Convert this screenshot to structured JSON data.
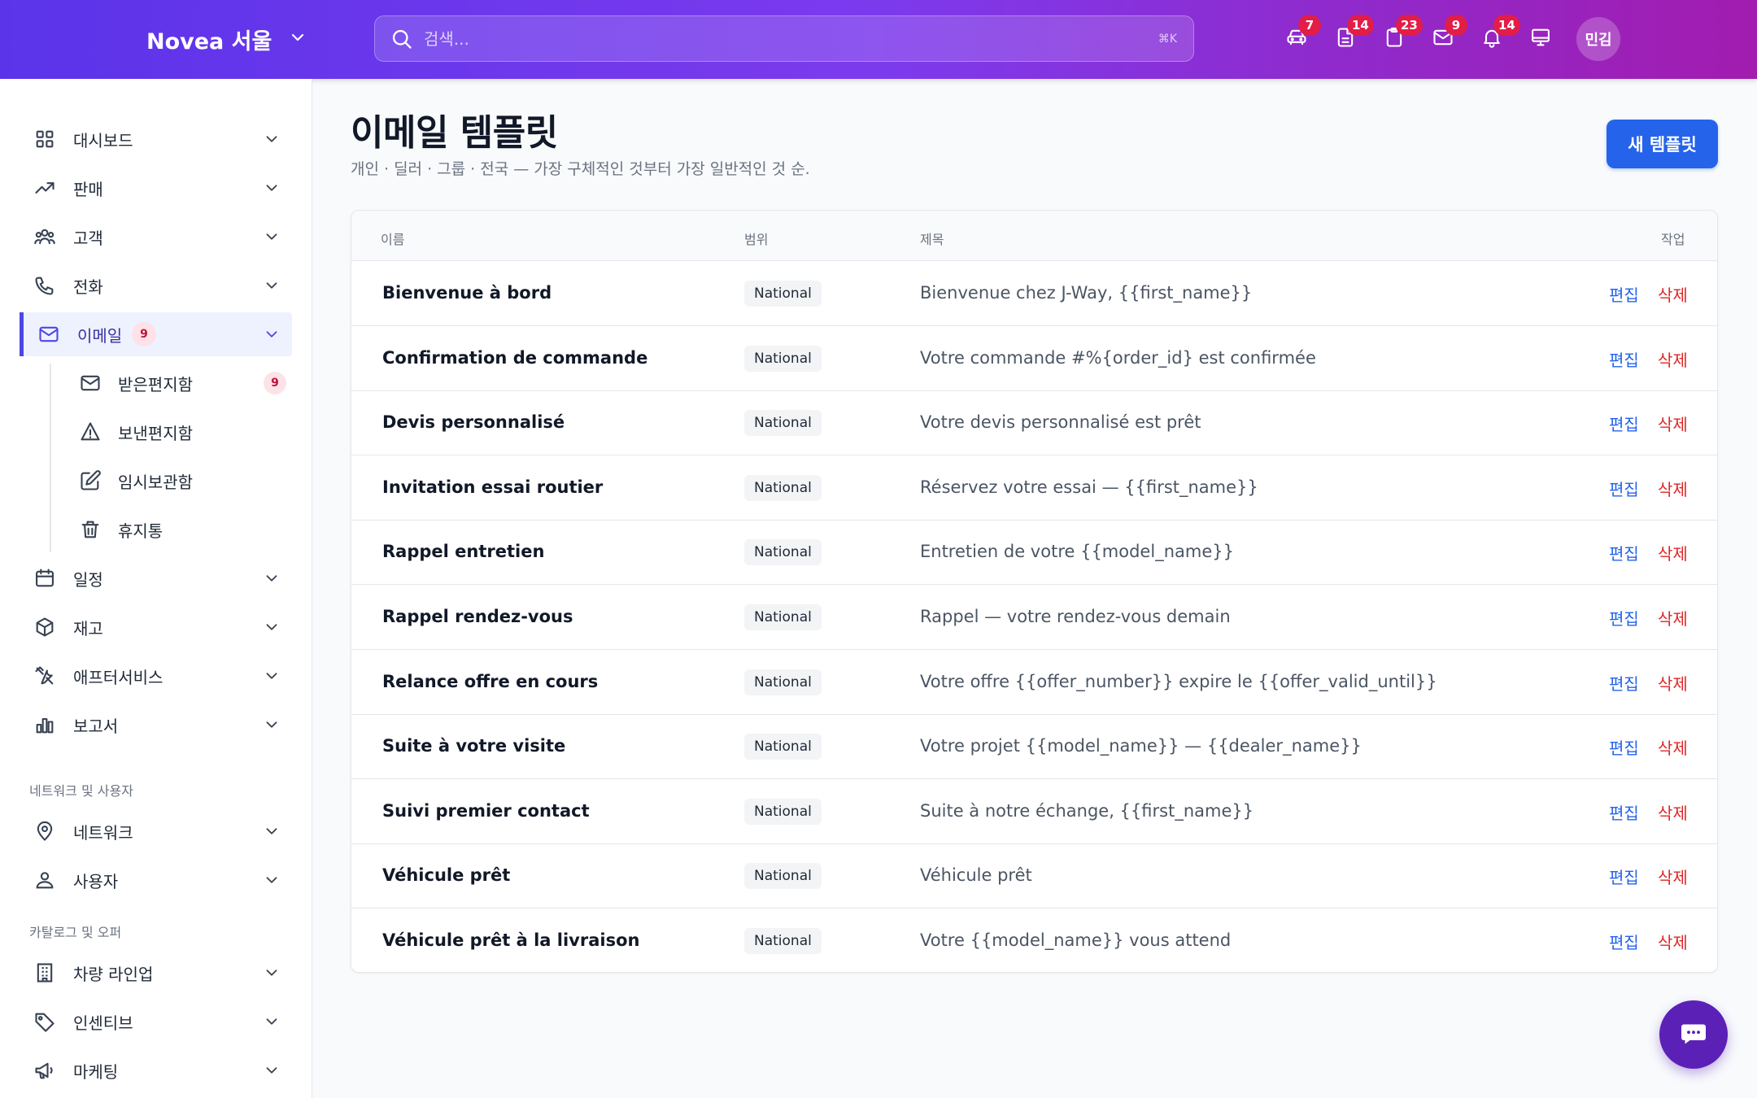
{
  "header": {
    "brand": "Novea 서울",
    "search_placeholder": "검색...",
    "search_shortcut": "⌘K",
    "icons": [
      {
        "icon": "car-icon",
        "badge": "7"
      },
      {
        "icon": "document-icon",
        "badge": "14"
      },
      {
        "icon": "clipboard-icon",
        "badge": "23"
      },
      {
        "icon": "mail-icon",
        "badge": "9"
      },
      {
        "icon": "bell-icon",
        "badge": "14"
      },
      {
        "icon": "monitor-icon",
        "badge": ""
      }
    ],
    "avatar_initials": "민김"
  },
  "sidebar": {
    "items": [
      {
        "label": "대시보드",
        "icon": "grid-icon"
      },
      {
        "label": "판매",
        "icon": "trending-up-icon"
      },
      {
        "label": "고객",
        "icon": "users-icon"
      },
      {
        "label": "전화",
        "icon": "phone-icon"
      },
      {
        "label": "이메일",
        "icon": "mail-icon",
        "badge": "9",
        "active": true
      },
      {
        "label": "일정",
        "icon": "calendar-icon"
      },
      {
        "label": "재고",
        "icon": "box-icon"
      },
      {
        "label": "애프터서비스",
        "icon": "tools-icon"
      },
      {
        "label": "보고서",
        "icon": "bar-chart-icon"
      }
    ],
    "email_sub": [
      {
        "label": "받은편지함",
        "icon": "inbox-icon",
        "badge": "9"
      },
      {
        "label": "보낸편지함",
        "icon": "send-icon"
      },
      {
        "label": "임시보관함",
        "icon": "edit-icon"
      },
      {
        "label": "휴지통",
        "icon": "trash-icon"
      }
    ],
    "section_network": "네트워크 및 사용자",
    "network_items": [
      {
        "label": "네트워크",
        "icon": "map-pin-icon"
      },
      {
        "label": "사용자",
        "icon": "user-icon"
      }
    ],
    "section_catalog": "카탈로그 및 오퍼",
    "catalog_items": [
      {
        "label": "차량 라인업",
        "icon": "building-icon"
      },
      {
        "label": "인센티브",
        "icon": "tag-icon"
      },
      {
        "label": "마케팅",
        "icon": "megaphone-icon"
      }
    ]
  },
  "main": {
    "title": "이메일 템플릿",
    "subtitle": "개인 · 딜러 · 그룹 · 전국 — 가장 구체적인 것부터 가장 일반적인 것 순.",
    "new_button": "새 템플릿",
    "table": {
      "headers": {
        "name": "이름",
        "scope": "범위",
        "subject": "제목",
        "actions": "작업"
      },
      "edit_label": "편집",
      "delete_label": "삭제",
      "rows": [
        {
          "name": "Bienvenue à bord",
          "scope": "National",
          "subject": "Bienvenue chez J-Way, {{first_name}}"
        },
        {
          "name": "Confirmation de commande",
          "scope": "National",
          "subject": "Votre commande #%{order_id} est confirmée"
        },
        {
          "name": "Devis personnalisé",
          "scope": "National",
          "subject": "Votre devis personnalisé est prêt"
        },
        {
          "name": "Invitation essai routier",
          "scope": "National",
          "subject": "Réservez votre essai — {{first_name}}"
        },
        {
          "name": "Rappel entretien",
          "scope": "National",
          "subject": "Entretien de votre {{model_name}}"
        },
        {
          "name": "Rappel rendez-vous",
          "scope": "National",
          "subject": "Rappel — votre rendez-vous demain"
        },
        {
          "name": "Relance offre en cours",
          "scope": "National",
          "subject": "Votre offre {{offer_number}} expire le {{offer_valid_until}}"
        },
        {
          "name": "Suite à votre visite",
          "scope": "National",
          "subject": "Votre projet {{model_name}} — {{dealer_name}}"
        },
        {
          "name": "Suivi premier contact",
          "scope": "National",
          "subject": "Suite à notre échange, {{first_name}}"
        },
        {
          "name": "Véhicule prêt",
          "scope": "National",
          "subject": "Véhicule prêt"
        },
        {
          "name": "Véhicule prêt à la livraison",
          "scope": "National",
          "subject": "Votre {{model_name}} vous attend"
        }
      ]
    }
  },
  "colors": {
    "accent": "#2563eb",
    "danger": "#dc2626",
    "brand_gradient_start": "#5b34ea",
    "brand_gradient_end": "#a21caf"
  }
}
